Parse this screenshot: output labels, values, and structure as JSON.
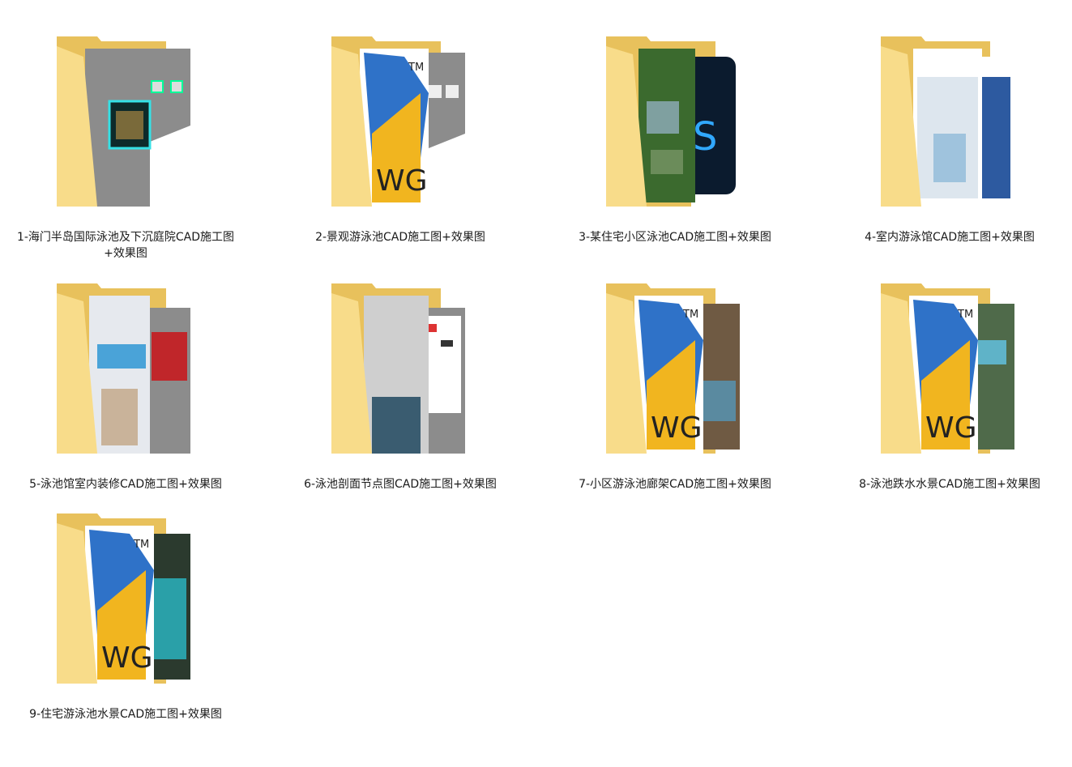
{
  "folders": [
    {
      "name": "1-海门半岛国际泳池及下沉庭院CAD施工图+效果图",
      "preview": "gray-cad"
    },
    {
      "name": "2-景观游泳池CAD施工图+效果图",
      "preview": "dwg-gray"
    },
    {
      "name": "3-某住宅小区泳池CAD施工图+效果图",
      "preview": "garden-ps"
    },
    {
      "name": "4-室内游泳馆CAD施工图+效果图",
      "preview": "interior-blue"
    },
    {
      "name": "5-泳池馆室内装修CAD施工图+效果图",
      "preview": "interior-red"
    },
    {
      "name": "6-泳池剖面节点图CAD施工图+效果图",
      "preview": "section-gray"
    },
    {
      "name": "7-小区游泳池廊架CAD施工图+效果图",
      "preview": "dwg-photo"
    },
    {
      "name": "8-泳池跌水水景CAD施工图+效果图",
      "preview": "dwg-photo"
    },
    {
      "name": "9-住宅游泳池水景CAD施工图+效果图",
      "preview": "dwg-pool"
    }
  ],
  "colors": {
    "folder_back": "#e8c15c",
    "folder_front": "#f8dc8a",
    "dwg_blue": "#2f72c8",
    "dwg_yellow": "#f1b51f",
    "cad_gray": "#8c8c8c"
  },
  "badges": {
    "dwg_text": "DWG",
    "tm": "TM",
    "ps": "Ps"
  }
}
